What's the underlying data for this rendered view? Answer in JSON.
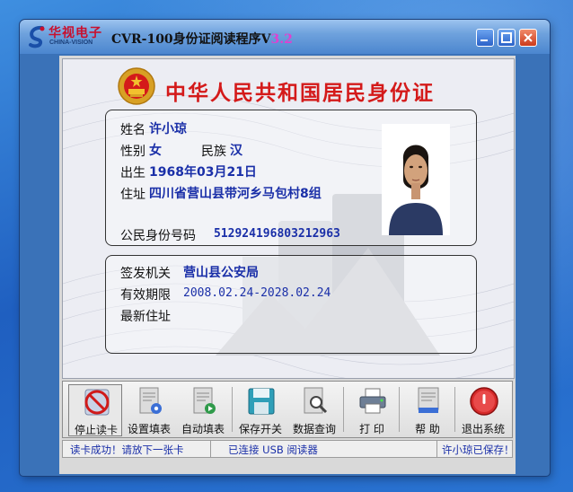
{
  "app": {
    "logo_cn": "华视电子",
    "logo_en": "CHINA-VISION",
    "title_main": "CVR-100身份证阅读程序V",
    "title_version": "3.2"
  },
  "card": {
    "title": "中华人民共和国居民身份证",
    "labels": {
      "name": "姓名",
      "sex": "性别",
      "ethnicity": "民族",
      "birth": "出生",
      "address": "住址",
      "id_number": "公民身份号码",
      "authority": "签发机关",
      "validity": "有效期限",
      "new_address": "最新住址"
    },
    "values": {
      "name": "许小琼",
      "sex": "女",
      "ethnicity": "汉",
      "birth": "1968年03月21日",
      "address": "四川省营山县带河乡马包村8组",
      "id_number": "512924196803212963",
      "authority": "营山县公安局",
      "validity": "2008.02.24-2028.02.24",
      "new_address": ""
    }
  },
  "toolbar": {
    "buttons": [
      {
        "label": "停止读卡",
        "icon": "stop-read-icon"
      },
      {
        "label": "设置填表",
        "icon": "form-settings-icon"
      },
      {
        "label": "自动填表",
        "icon": "auto-fill-icon"
      },
      {
        "label": "保存开关",
        "icon": "save-disk-icon"
      },
      {
        "label": "数据查询",
        "icon": "data-search-icon"
      },
      {
        "label": "打 印",
        "icon": "printer-icon"
      },
      {
        "label": "帮 助",
        "icon": "help-icon"
      },
      {
        "label": "退出系统",
        "icon": "power-exit-icon"
      }
    ]
  },
  "status": {
    "message": "读卡成功！请放下一张卡",
    "connection": "已连接 USB 阅读器",
    "saved": "许小琼已保存！"
  },
  "colors": {
    "title_red": "#d41a1a",
    "value_blue": "#1a2fa8",
    "version_magenta": "#e040d0"
  }
}
